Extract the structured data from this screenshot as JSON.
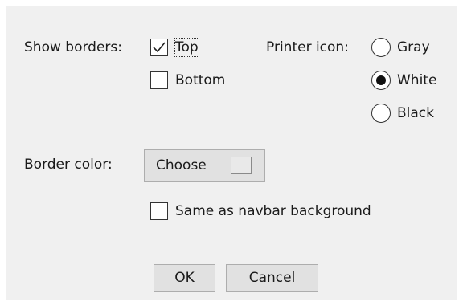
{
  "dialog": {
    "show_borders_label": "Show borders:",
    "top_label": "Top",
    "top_checked": true,
    "bottom_label": "Bottom",
    "bottom_checked": false,
    "printer_icon_label": "Printer icon:",
    "printer_options": [
      {
        "label": "Gray",
        "selected": false
      },
      {
        "label": "White",
        "selected": true
      },
      {
        "label": "Black",
        "selected": false
      }
    ],
    "border_color_label": "Border color:",
    "choose_label": "Choose",
    "swatch_color": "#e9e9e9",
    "same_as_navbar_label": "Same as navbar background",
    "same_as_navbar_checked": false,
    "ok_label": "OK",
    "cancel_label": "Cancel"
  }
}
